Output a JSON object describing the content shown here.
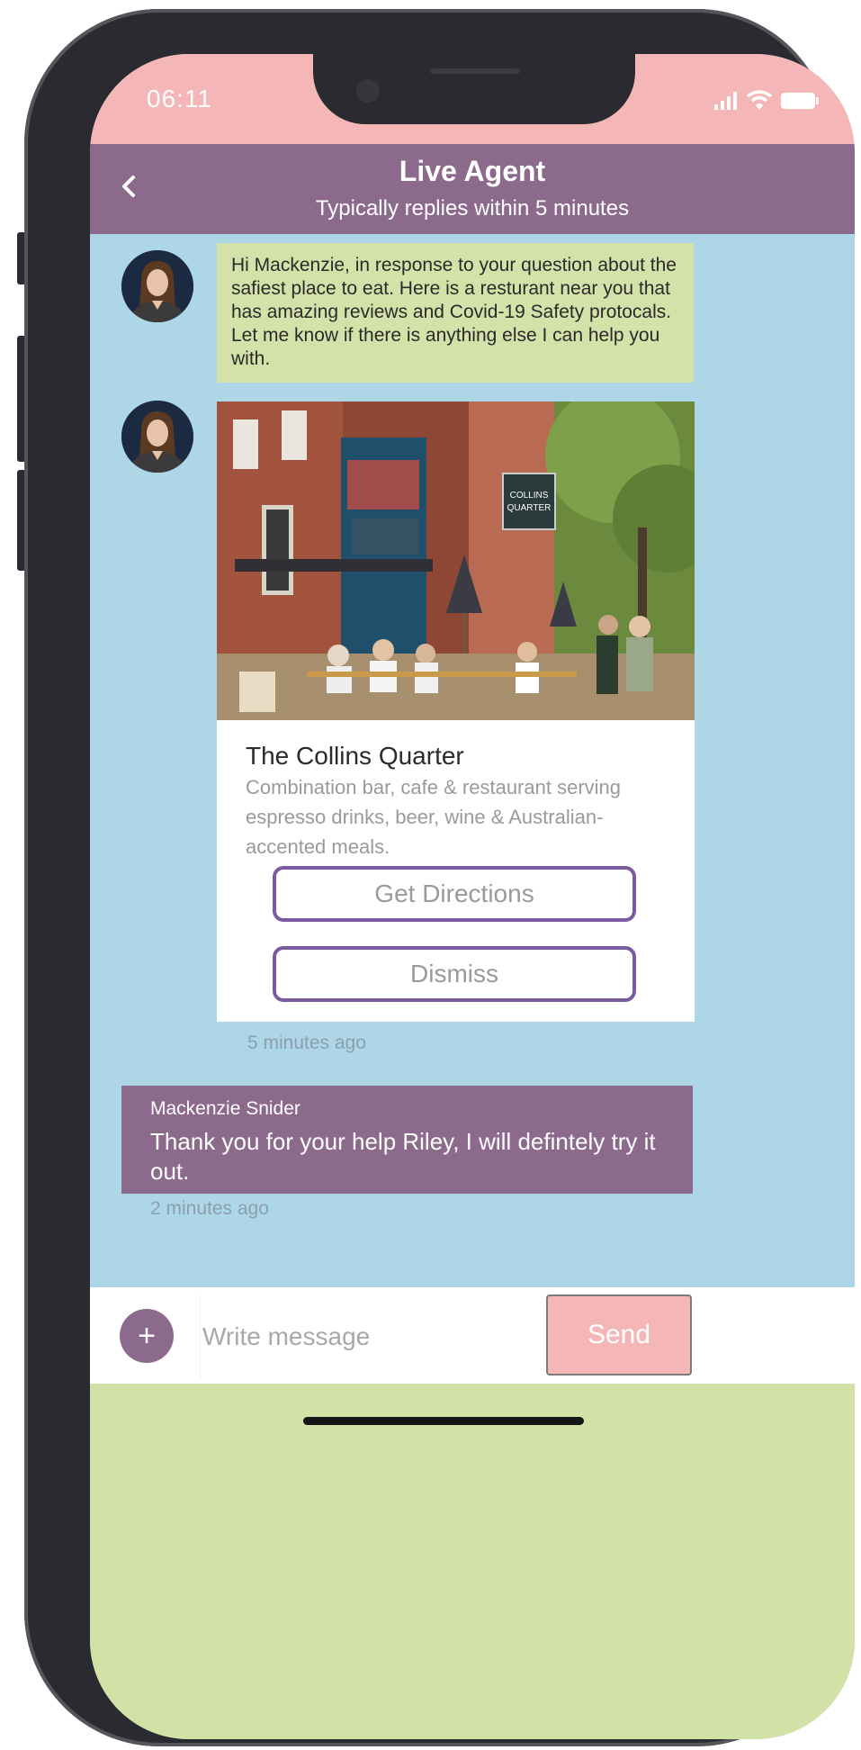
{
  "status_bar": {
    "time": "06:11"
  },
  "header": {
    "title": "Live Agent",
    "subtitle": "Typically replies within 5 minutes"
  },
  "agent_message": {
    "text": "Hi Mackenzie, in response to your question about the safiest place to eat. Here is a resturant near you that has amazing reviews and Covid-19 Safety protocals. Let me know if there is anything else I can help you with."
  },
  "recommendation_card": {
    "sign_text_line1": "COLLINS",
    "sign_text_line2": "QUARTER",
    "title": "The Collins Quarter",
    "description": "Combination bar, cafe & restaurant serving espresso drinks, beer, wine & Australian-accented meals.",
    "directions_label": "Get Directions",
    "dismiss_label": "Dismiss",
    "timestamp": "5 minutes ago"
  },
  "user_message": {
    "sender": "Mackenzie Snider",
    "text": "Thank you for your help Riley, I will defintely try it out.",
    "timestamp": "2 minutes ago"
  },
  "composer": {
    "attach_label": "+",
    "placeholder": "Write message",
    "send_label": "Send"
  },
  "colors": {
    "status_bar_bg": "#f4b6b6",
    "header_bg": "#8c6a8c",
    "chat_bg": "#add6e6",
    "agent_bubble_bg": "#d4e2aa",
    "button_border": "#7a5ba0",
    "send_button_bg": "#f4b6b6",
    "footer_bg": "#d2e1a6"
  },
  "icons": {
    "back": "chevron-left-icon",
    "signal": "signal-icon",
    "wifi": "wifi-icon",
    "battery": "battery-icon",
    "attach": "plus-icon"
  }
}
